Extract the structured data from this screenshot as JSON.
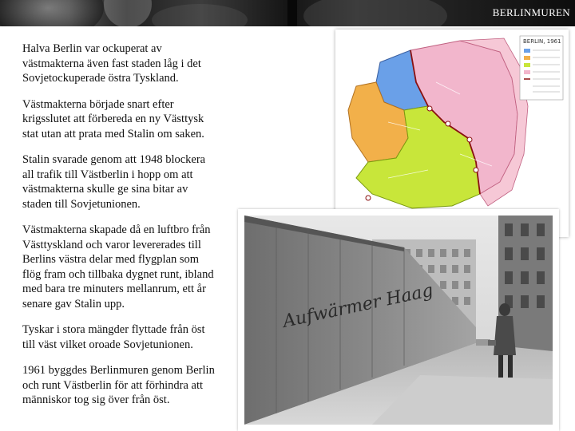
{
  "banner": {
    "title": "BERLINMUREN"
  },
  "paragraphs": [
    "Halva Berlin var ockuperat av\nvästmakterna även fast staden låg i det\nSovjetockuperade östra Tyskland.",
    "Västmakterna började snart efter\nkrigsslutet att förbereda en ny Västtysk\nstat utan att prata med Stalin om saken.",
    "Stalin svarade genom att 1948 blockera\nall trafik till Västberlin i hopp om att\nvästmakterna skulle ge sina bitar av\nstaden till Sovjetunionen.",
    "Västmakterna skapade då en luftbro från\nVästtyskland och varor levererades till\nBerlins västra delar med flygplan som\nflög fram och tillbaka dygnet runt, ibland\nmed bara tre minuters mellanrum, ett år\nsenare gav Stalin upp.",
    "Tyskar i stora mängder flyttade från öst\ntill väst vilket oroade Sovjetunionen.",
    "1961 byggdes Berlinmuren genom Berlin\noch runt Västberlin för att förhindra att\nmänniskor tog sig över från öst."
  ],
  "map": {
    "title": "BERLIN, 1961",
    "colors": {
      "french": "#6aa0e8",
      "british": "#f2b04a",
      "american": "#c8e63a",
      "soviet": "#f2b6cc",
      "background": "#ffffff"
    }
  },
  "photo": {
    "graffiti": "Aufwärmer Haag"
  }
}
